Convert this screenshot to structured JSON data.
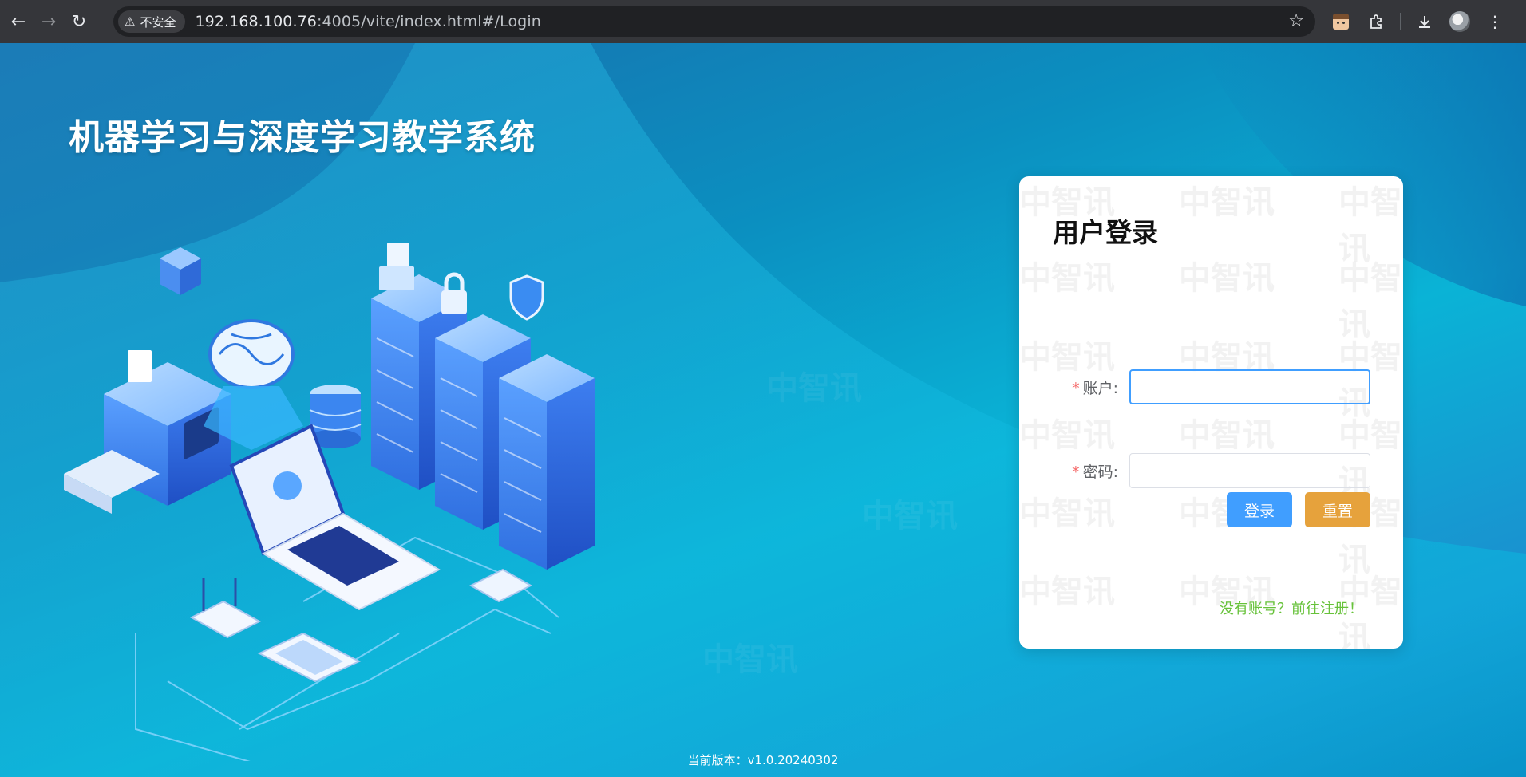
{
  "browser": {
    "security_label": "不安全",
    "url_host": "192.168.100.76",
    "url_path": ":4005/vite/index.html#/Login"
  },
  "page": {
    "system_title": "机器学习与深度学习教学系统",
    "watermark_text": "中智讯",
    "version_text": "当前版本：v1.0.20240302"
  },
  "login": {
    "title": "用户登录",
    "required_mark": "*",
    "account_label": "账户:",
    "account_value": "",
    "password_label": "密码:",
    "password_value": "",
    "login_button": "登录",
    "reset_button": "重置",
    "register_link": "没有账号？前往注册！"
  },
  "colors": {
    "primary": "#409eff",
    "warning": "#e6a23c",
    "success": "#67c23a",
    "danger": "#f56c6c"
  }
}
